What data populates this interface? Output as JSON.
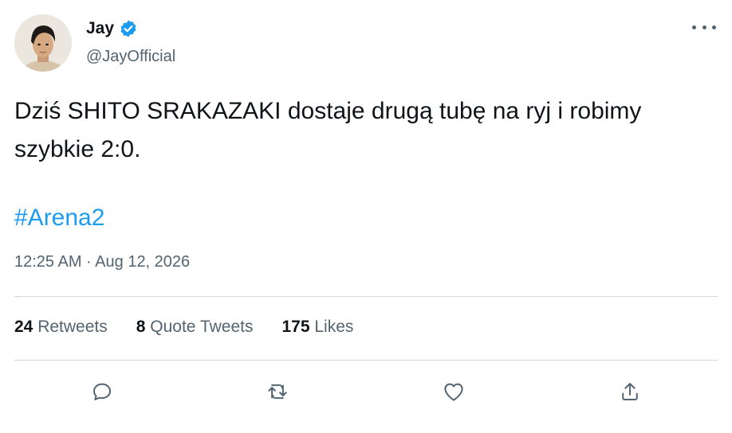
{
  "author": {
    "display_name": "Jay",
    "handle": "@JayOfficial",
    "verified_color": "#1d9bf0"
  },
  "tweet": {
    "text": "Dziś SHITO SRAKAZAKI dostaje drugą tubę na ryj i robimy szybkie 2:0.",
    "hashtag": "#Arena2",
    "timestamp": "12:25 AM · Aug 12, 2026"
  },
  "stats": {
    "retweets": {
      "count": "24",
      "label": "Retweets"
    },
    "quotes": {
      "count": "8",
      "label": "Quote Tweets"
    },
    "likes": {
      "count": "175",
      "label": "Likes"
    }
  },
  "actions": {
    "reply_icon": "speech-bubble-icon",
    "retweet_icon": "retweet-icon",
    "like_icon": "heart-icon",
    "share_icon": "share-upload-icon"
  },
  "colors": {
    "text": "#0f1419",
    "secondary": "#536471",
    "accent": "#1d9bf0",
    "divider": "#cfd9de"
  }
}
